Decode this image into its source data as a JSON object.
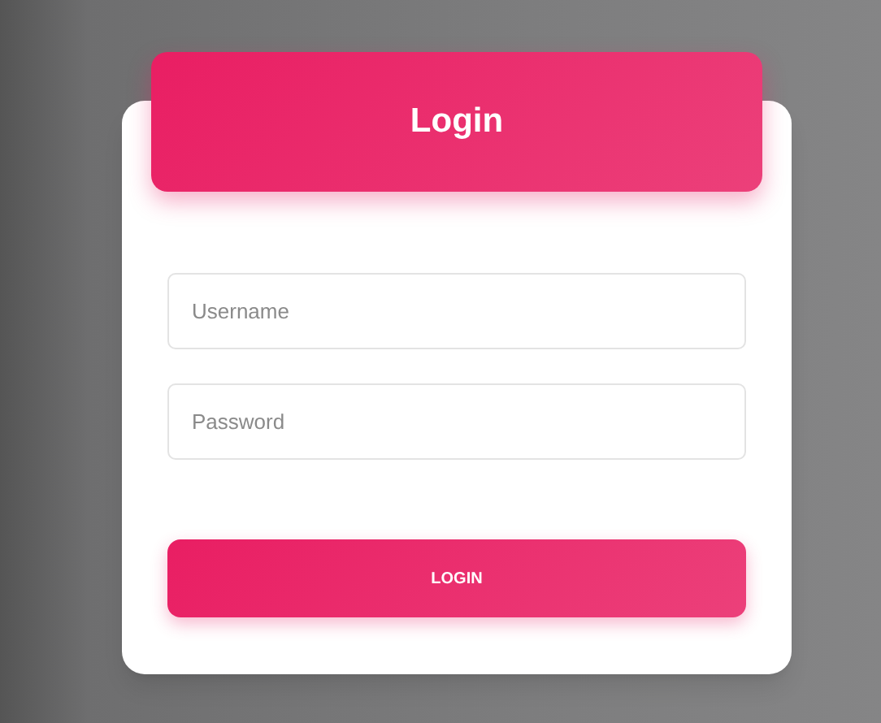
{
  "header": {
    "title": "Login"
  },
  "fields": [
    {
      "placeholder": "Username"
    },
    {
      "placeholder": "Password"
    }
  ],
  "button": {
    "label": "LOGIN"
  }
}
